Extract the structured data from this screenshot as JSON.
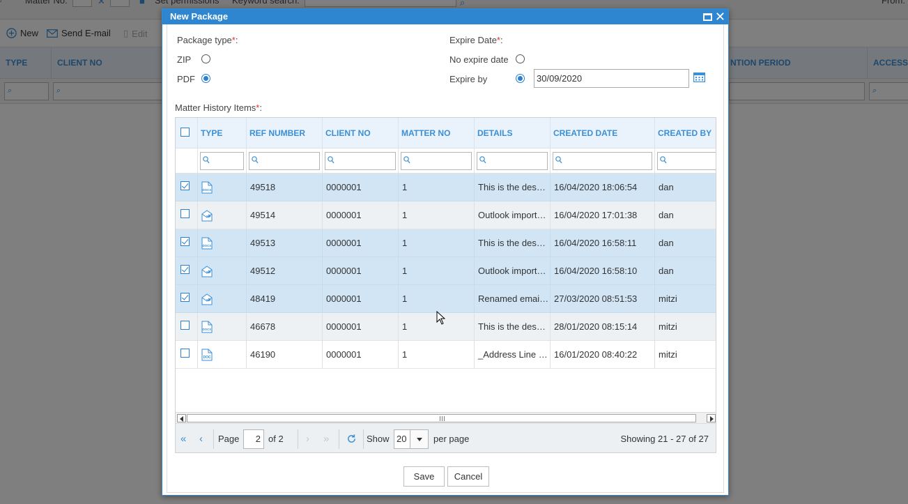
{
  "background": {
    "topbar": {
      "matter_no_label": "Matter No:",
      "set_permissions": "Set permissions",
      "keyword_search": "Keyword search:",
      "from_label": "From:"
    },
    "toolbar": {
      "new_label": "New",
      "send_email_label": "Send E-mail",
      "edit_label": "Edit"
    },
    "columns": {
      "type": "TYPE",
      "client_no": "CLIENT NO",
      "retention": "NTION PERIOD",
      "access": "ACCESS L"
    }
  },
  "dialog": {
    "title": "New Package",
    "package_type": {
      "label": "Package type",
      "required_mark": "*",
      "colon": ":",
      "options": [
        {
          "label": "ZIP",
          "selected": false
        },
        {
          "label": "PDF",
          "selected": true
        }
      ]
    },
    "expire": {
      "label": "Expire Date",
      "required_mark": "*",
      "colon": ":",
      "no_expire_label": "No expire date",
      "no_expire_selected": false,
      "expire_by_label": "Expire by",
      "expire_by_selected": true,
      "date_value": "30/09/2020"
    },
    "items": {
      "label": "Matter History Items",
      "required_mark": "*",
      "colon": ":",
      "headers": [
        "TYPE",
        "REF NUMBER",
        "CLIENT NO",
        "MATTER NO",
        "DETAILS",
        "CREATED DATE",
        "CREATED BY"
      ],
      "rows": [
        {
          "checked": true,
          "icon": "docx-file-icon",
          "ref": "49518",
          "client": "0000001",
          "matter": "1",
          "details": "This is the description",
          "created": "16/04/2020 18:06:54",
          "by": "dan"
        },
        {
          "checked": false,
          "icon": "email-file-icon",
          "ref": "49514",
          "client": "0000001",
          "matter": "1",
          "details": "Outlook imported email",
          "created": "16/04/2020 17:01:38",
          "by": "dan"
        },
        {
          "checked": true,
          "icon": "docx-file-icon",
          "ref": "49513",
          "client": "0000001",
          "matter": "1",
          "details": "This is the description",
          "created": "16/04/2020 16:58:11",
          "by": "dan"
        },
        {
          "checked": true,
          "icon": "email-file-icon",
          "ref": "49512",
          "client": "0000001",
          "matter": "1",
          "details": "Outlook imported email",
          "created": "16/04/2020 16:58:10",
          "by": "dan"
        },
        {
          "checked": true,
          "icon": "email-file-icon",
          "ref": "48419",
          "client": "0000001",
          "matter": "1",
          "details": "Renamed email subject",
          "created": "27/03/2020 08:51:53",
          "by": "mitzi"
        },
        {
          "checked": false,
          "icon": "docx-file-icon",
          "ref": "46678",
          "client": "0000001",
          "matter": "1",
          "details": "This is the description",
          "created": "28/01/2020 08:15:14",
          "by": "mitzi"
        },
        {
          "checked": false,
          "icon": "doc-file-icon",
          "ref": "46190",
          "client": "0000001",
          "matter": "1",
          "details": "_Address Line details",
          "created": "16/01/2020 08:40:22",
          "by": "mitzi"
        }
      ]
    },
    "pager": {
      "page_label": "Page",
      "page_value": "2",
      "of_label": "of 2",
      "show_label": "Show",
      "page_size": "20",
      "per_page_label": "per page",
      "summary": "Showing 21 - 27 of 27"
    },
    "buttons": {
      "save": "Save",
      "cancel": "Cancel"
    }
  }
}
